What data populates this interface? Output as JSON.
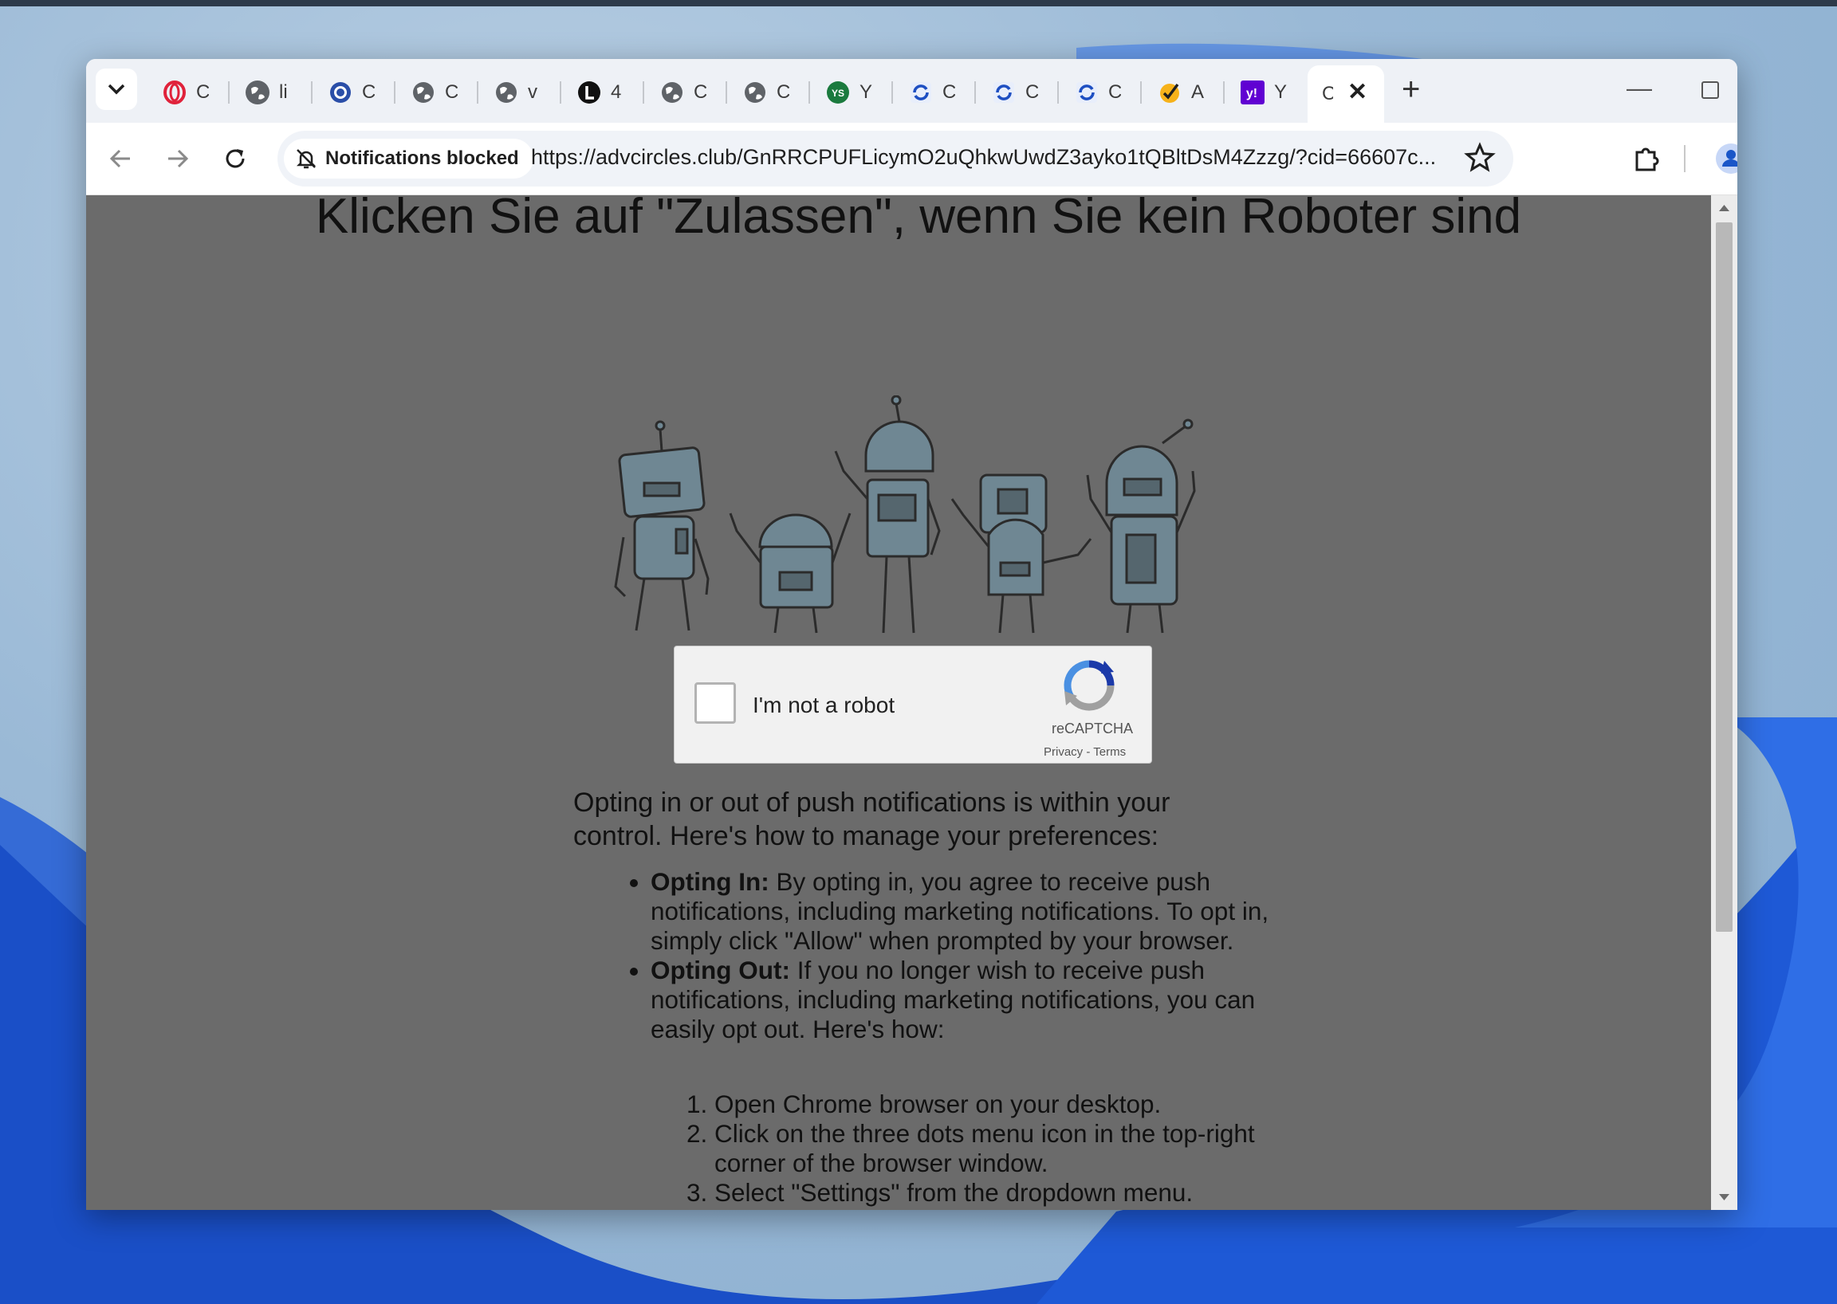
{
  "browser": {
    "tabs": [
      {
        "icon": "opera-icon",
        "title": "C"
      },
      {
        "icon": "globe-icon",
        "title": "li"
      },
      {
        "icon": "logo-icon",
        "title": "C"
      },
      {
        "icon": "globe-icon",
        "title": "C"
      },
      {
        "icon": "globe-icon",
        "title": "v"
      },
      {
        "icon": "letter-l-icon",
        "title": "4"
      },
      {
        "icon": "globe-icon",
        "title": "C"
      },
      {
        "icon": "globe-icon",
        "title": "C"
      },
      {
        "icon": "ys-icon",
        "title": "Y"
      },
      {
        "icon": "refresh-logo-icon",
        "title": "C"
      },
      {
        "icon": "refresh-logo-icon",
        "title": "C"
      },
      {
        "icon": "refresh-logo-icon",
        "title": "C"
      },
      {
        "icon": "checkmark-icon",
        "title": "A"
      },
      {
        "icon": "yahoo-icon",
        "title": "Y"
      }
    ],
    "active_tab_title": "C",
    "notification_chip": "Notifications blocked",
    "url": "https://advcircles.club/GnRRCPUFLicymO2uQhkwUwdZ3ayko1tQBltDsM4Zzzg/?cid=66607c..."
  },
  "page": {
    "headline": "Klicken Sie auf \"Zulassen\", wenn Sie kein Roboter sind",
    "captcha": {
      "label": "I'm not a robot",
      "brand": "reCAPTCHA",
      "links": "Privacy - Terms"
    },
    "intro": "Opting in or out of push notifications is within your control. Here's how to manage your preferences:",
    "bullets": [
      {
        "bold": "Opting In:",
        "text": " By opting in, you agree to receive push notifications, including marketing notifications. To opt in, simply click \"Allow\" when prompted by your browser."
      },
      {
        "bold": "Opting Out:",
        "text": " If you no longer wish to receive push notifications, including marketing notifications, you can easily opt out. Here's how:"
      }
    ],
    "steps": [
      "Open Chrome browser on your desktop.",
      "Click on the three dots menu icon in the top-right corner of the browser window.",
      "Select \"Settings\" from the dropdown menu."
    ]
  }
}
